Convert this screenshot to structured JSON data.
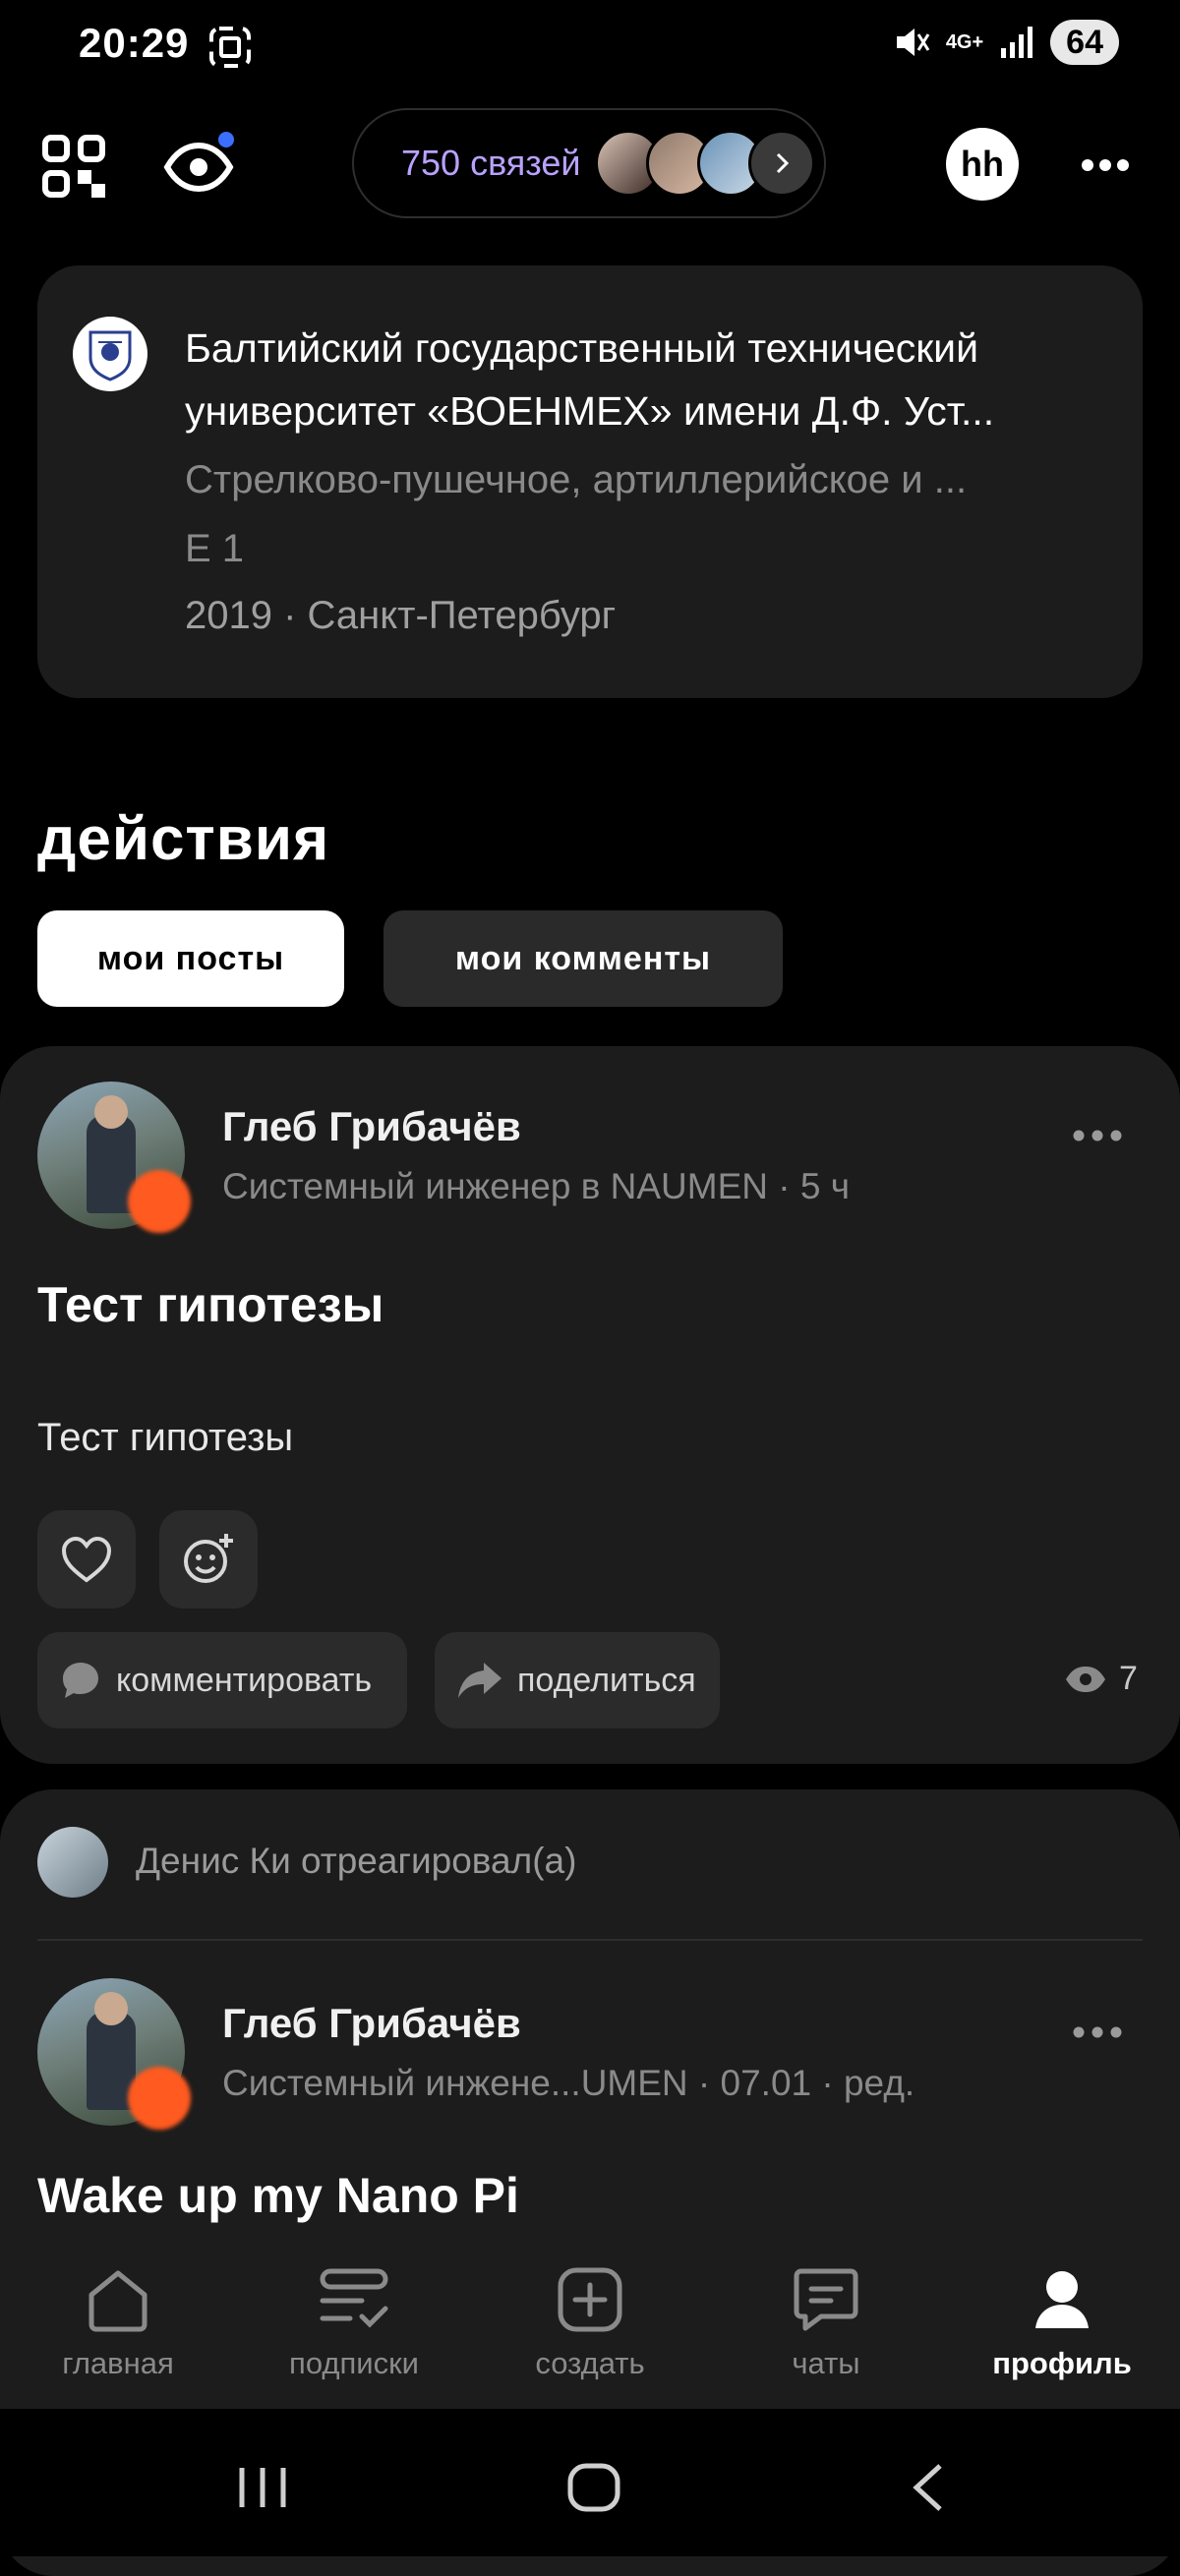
{
  "status_bar": {
    "time": "20:29",
    "battery": "64",
    "network": "4G+"
  },
  "top_bar": {
    "connections_label": "750 связей",
    "profile_badge": "hh"
  },
  "education": {
    "university": "Балтийский государственный технический университет «ВОЕНМЕХ» имени Д.Ф. Уст...",
    "faculty": "Стрелково-пушечное, артиллерийское и ...",
    "group": "Е 1",
    "year_city": "2019 · Санкт-Петербург"
  },
  "actions": {
    "heading": "действия",
    "tabs": [
      {
        "label": "мои посты",
        "active": true
      },
      {
        "label": "мои комменты",
        "active": false
      }
    ]
  },
  "posts": [
    {
      "author": "Глеб Грибачёв",
      "subtitle": "Системный инженер в NAUMEN · 5 ч",
      "title": "Тест гипотезы",
      "body": "Тест гипотезы",
      "comment_label": "комментировать",
      "share_label": "поделиться",
      "views": "7"
    },
    {
      "reaction_text": "Денис Ки отреагировал(а)",
      "author": "Глеб Грибачёв",
      "subtitle": "Системный инжене...UMEN · 07.01 · ред.",
      "title": "Wake up my Nano Pi"
    }
  ],
  "bottom_nav": [
    {
      "label": "главная",
      "icon": "home-icon",
      "active": false
    },
    {
      "label": "подписки",
      "icon": "subscriptions-icon",
      "active": false
    },
    {
      "label": "создать",
      "icon": "create-icon",
      "active": false
    },
    {
      "label": "чаты",
      "icon": "chat-icon",
      "active": false
    },
    {
      "label": "профиль",
      "icon": "profile-icon",
      "active": true
    }
  ],
  "colors": {
    "accent": "#b9a2ff",
    "card": "#1c1c1c",
    "background": "#000000",
    "badge": "#ff5a1f"
  }
}
